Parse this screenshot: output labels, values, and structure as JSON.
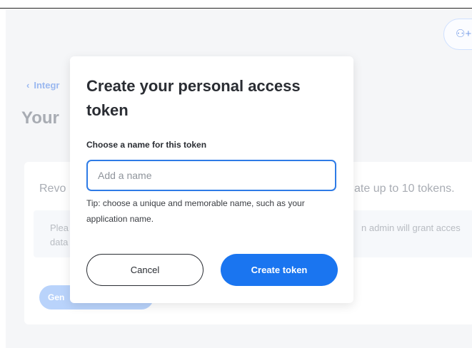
{
  "background": {
    "back_link": "Integr",
    "page_title": "Your",
    "card": {
      "revoke_text": "Revo",
      "limit_text": "ate up to 10 tokens.",
      "info_line1": "Plea",
      "info_line2": "data",
      "info_right": "n admin will grant acces",
      "generate_label": "Gen"
    },
    "invite_icon": "add-user-icon"
  },
  "modal": {
    "title": "Create your personal access token",
    "field_label": "Choose a name for this token",
    "input_value": "",
    "input_placeholder": "Add a name",
    "tip": "Tip: choose a unique and memorable name, such as your application name.",
    "cancel_label": "Cancel",
    "create_label": "Create token"
  },
  "colors": {
    "primary": "#1a75f0",
    "input_border": "#2e7be6",
    "backdrop": "#f5f6f8"
  }
}
